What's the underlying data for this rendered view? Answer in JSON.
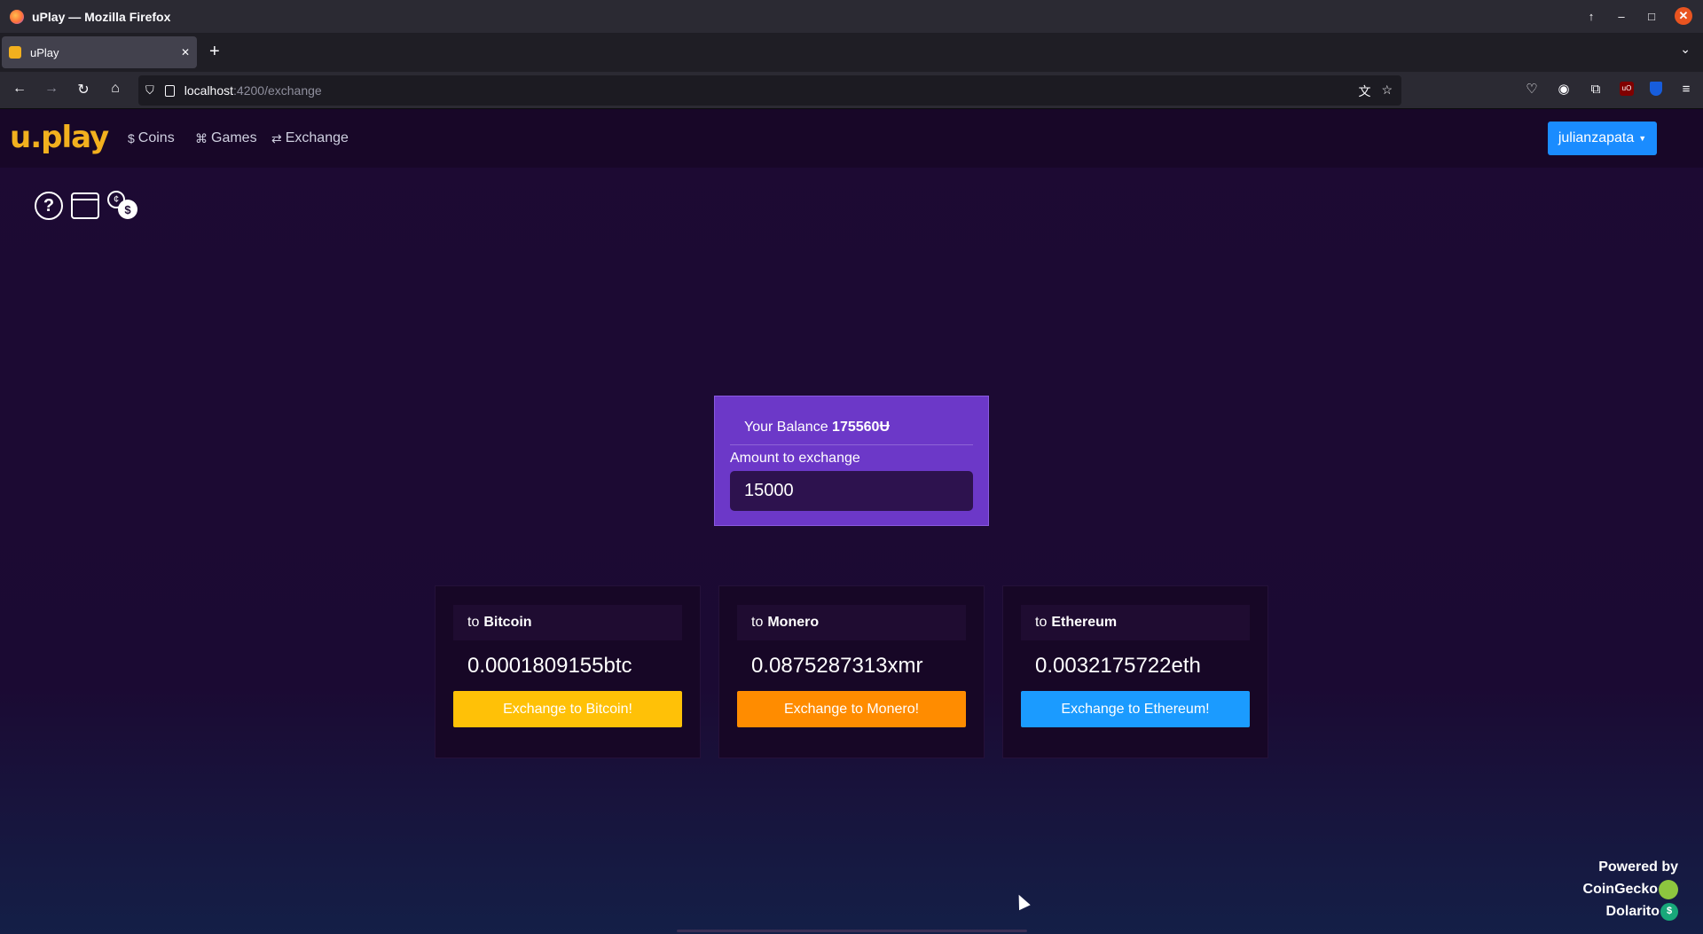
{
  "window": {
    "title": "uPlay — Mozilla Firefox"
  },
  "tab": {
    "title": "uPlay"
  },
  "address": {
    "host": "localhost",
    "path": ":4200/exchange"
  },
  "app": {
    "logo": "u.play",
    "nav": [
      {
        "label": "Coins",
        "icon": "coin-icon"
      },
      {
        "label": "Games",
        "icon": "gamepad-icon"
      },
      {
        "label": "Exchange",
        "icon": "exchange-icon"
      }
    ],
    "user_button": "julianzapata"
  },
  "balance": {
    "prefix": "Your Balance",
    "value": "175560",
    "currency_glyph": "Ʉ",
    "amount_label": "Amount to exchange",
    "amount_value": "15000"
  },
  "cards": [
    {
      "pre": "to",
      "coin": "Bitcoin",
      "value": "0.0001809155btc",
      "button": "Exchange to Bitcoin!",
      "color": "#ffc107"
    },
    {
      "pre": "to",
      "coin": "Monero",
      "value": "0.0875287313xmr",
      "button": "Exchange to Monero!",
      "color": "#ff8c00"
    },
    {
      "pre": "to",
      "coin": "Ethereum",
      "value": "0.0032175722eth",
      "button": "Exchange to Ethereum!",
      "color": "#1b9bff"
    }
  ],
  "footer": {
    "powered_by": "Powered by",
    "provider1": "CoinGecko",
    "provider2": "Dolarito"
  }
}
